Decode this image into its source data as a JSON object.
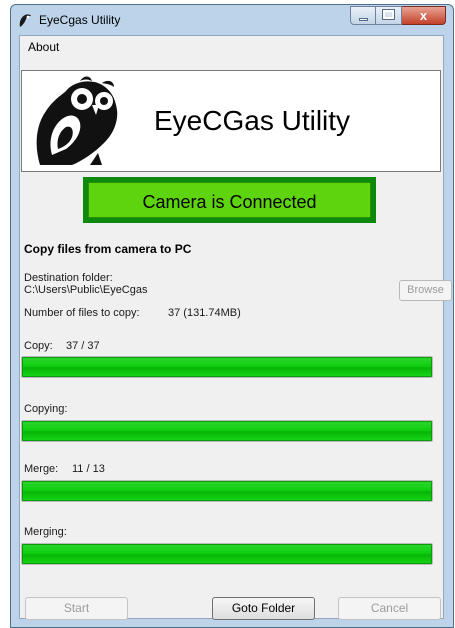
{
  "window": {
    "title": "EyeCgas Utility",
    "close_glyph": "x"
  },
  "menu": {
    "about": "About"
  },
  "banner": {
    "title": "EyeCGas Utility",
    "logo_icon": "owl-logo-icon"
  },
  "status": {
    "text": "Camera is Connected",
    "color": "#5ed40e"
  },
  "copy_section": {
    "title": "Copy files from camera to PC",
    "destination_label": "Destination folder:",
    "destination_path": "C:\\Users\\Public\\EyeCgas",
    "browse_label": "Browse",
    "files_label": "Number of files to copy:",
    "files_value": "37 (131.74MB)"
  },
  "progress": {
    "copy": {
      "label": "Copy:",
      "count": "37 / 37",
      "fraction": 1.0
    },
    "copying": {
      "label": "Copying:",
      "fraction": 1.0
    },
    "merge": {
      "label": "Merge:",
      "count": "11 / 13",
      "fraction": 1.0
    },
    "merging": {
      "label": "Merging:",
      "fraction": 1.0
    }
  },
  "buttons": {
    "start": "Start",
    "goto_folder": "Goto Folder",
    "cancel": "Cancel"
  }
}
